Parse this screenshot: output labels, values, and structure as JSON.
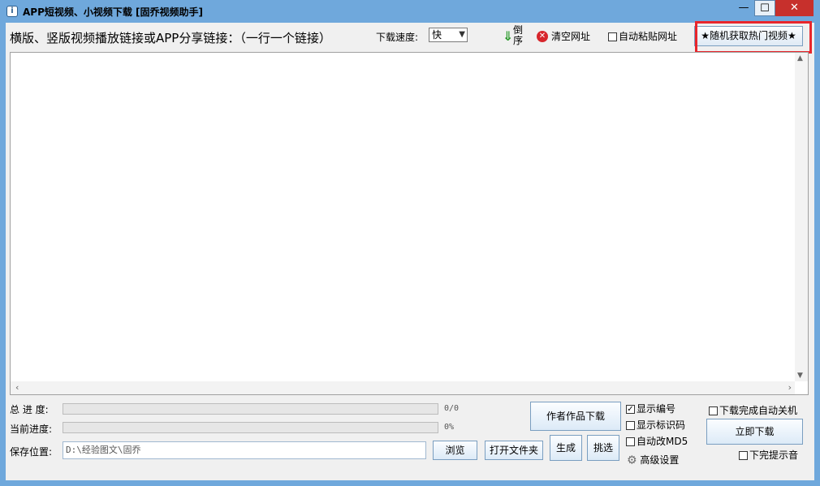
{
  "window": {
    "title": "APP短视频、小视频下载 [固乔视频助手]",
    "min_glyph": "—",
    "max_glyph": "☐",
    "close_glyph": "✕"
  },
  "toolbar": {
    "links_label": "横版、竖版视频播放链接或APP分享链接：（一行一个链接）",
    "speed_label": "下载速度:",
    "speed_value": "快",
    "reverse_label": "倒序",
    "clear_label": "清空网址",
    "auto_paste_label": "自动粘贴网址",
    "hot_video_button": "★随机获取热门视频★"
  },
  "progress": {
    "total_label": "总 进 度:",
    "total_text": "0/0",
    "total_value": 0,
    "current_label": "当前进度:",
    "current_text": "0%",
    "current_value": 0
  },
  "save": {
    "label": "保存位置:",
    "path": "D:\\经验图文\\固乔",
    "browse_button": "浏览",
    "open_folder_button": "打开文件夹"
  },
  "actions": {
    "author_download_button": "作者作品下载",
    "generate_button": "生成",
    "pick_button": "挑选",
    "download_now_button": "立即下载"
  },
  "options": {
    "show_number": {
      "label": "显示编号",
      "checked": true
    },
    "show_id_code": {
      "label": "显示标识码",
      "checked": false
    },
    "auto_md5": {
      "label": "自动改MD5",
      "checked": false
    },
    "advanced_settings": "高级设置",
    "auto_shutdown": {
      "label": "下载完成自动关机",
      "checked": false
    },
    "done_sound": {
      "label": "下完提示音",
      "checked": false
    }
  },
  "colors": {
    "titlebar": "#6fa8dc",
    "close_button": "#c7302c",
    "highlight": "#e8262c"
  }
}
